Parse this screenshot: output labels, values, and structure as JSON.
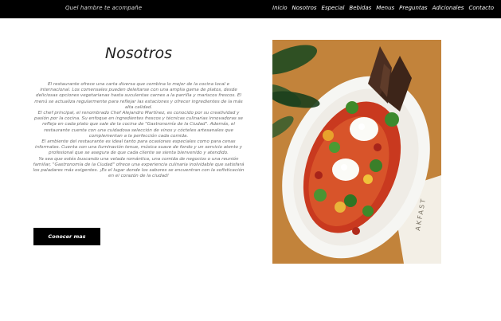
{
  "header": {
    "brand_text": "Quel hambre te acompañe",
    "nav": [
      {
        "label": "Inicio"
      },
      {
        "label": "Nosotros"
      },
      {
        "label": "Especial"
      },
      {
        "label": "Bebidas"
      },
      {
        "label": "Menus"
      },
      {
        "label": "Preguntas"
      },
      {
        "label": "Adicionales"
      },
      {
        "label": "Contacto"
      }
    ]
  },
  "main": {
    "title": "Nosotros",
    "paragraphs": [
      "El restaurante ofrece una carta diversa que combina lo mejor de la cocina local e internacional. Los comensales pueden deleitarse con una amplia gama de platos, desde deliciosas opciones vegetarianas hasta suculentas carnes a la parrilla y mariscos frescos. El menú se actualiza regularmente para reflejar las estaciones y ofrecer ingredientes de la más alta calidad.",
      "El chef principal, el renombrado Chef Alejandro Martínez, es conocido por su creatividad y pasión por la cocina. Su enfoque en ingredientes frescos y técnicas culinarias innovadoras se refleja en cada plato que sale de la cocina de \"Gastronomía de la Ciudad\". Además, el restaurante cuenta con una cuidadosa selección de vinos y cócteles artesanales que complementan a la perfección cada comida.",
      "El ambiente del restaurante es ideal tanto para ocasiones especiales como para cenas informales. Cuenta con una iluminación tenue, música suave de fondo y un servicio atento y profesional que se asegura de que cada cliente se sienta bienvenido y atendido.",
      "Ya sea que estés buscando una velada romántica, una comida de negocios o una reunión familiar, \"Gastronomía de la Ciudad\" ofrece una experiencia culinaria inolvidable que satisfará los paladares más exigentes. ¡Es el lugar donde los sabores se encuentran con la sofisticación en el corazón de la ciudad!"
    ],
    "cta_label": "Conocer mas"
  },
  "photo": {
    "menu_text": "AKFAST"
  }
}
